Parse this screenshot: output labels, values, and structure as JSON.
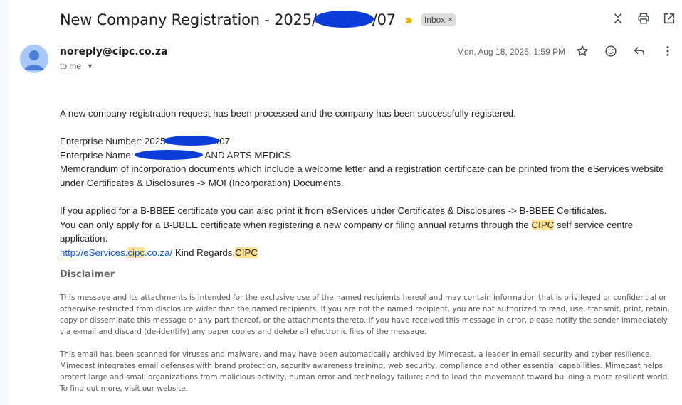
{
  "email": {
    "subject_prefix": "New Company Registration - 2025/",
    "subject_suffix": "/07",
    "label_chip": "Inbox",
    "label_chip_close": "×",
    "sender": "noreply@cipc.co.za",
    "recipient_label": "to me",
    "date": "Mon, Aug 18, 2025, 1:59 PM"
  },
  "body": {
    "intro": "A new company registration request has been processed and the company has been successfully registered.",
    "enterprise_number_prefix": "Enterprise Number: 2025",
    "enterprise_number_suffix": "/07",
    "enterprise_name_prefix": "Enterprise Name:",
    "enterprise_name_suffix": "AND ARTS MEDICS",
    "memorandum": "Memorandum of incorporation documents which include a welcome letter and a registration certificate can be printed from the eServices website under Certificates & Disclosures -> MOI (Incorporation) Documents.",
    "bbbee_1": "If you applied for a B-BBEE certificate you can also print it from eServices under Certificates & Disclosures -> B-BBEE Certificates.",
    "bbbee_2_before": "You can only apply for a B-BBEE certificate when registering a new company or filing annual returns through the ",
    "bbbee_2_highlight": "CIPC",
    "bbbee_2_after": " self service centre application.",
    "link_part1": "http://eServices.",
    "link_highlight": "cipc",
    "link_part2": ".co.za/",
    "regards": " Kind Regards,",
    "signature": "CIPC"
  },
  "disclaimer": {
    "title": "Disclaimer",
    "paragraph_1": "This message and its attachments is intended for the exclusive use of the named recipients hereof and may contain information that is privileged or confidential or otherwise restricted from disclosure wider than the named recipients. If you are not the named recipient, you are not authorized to read, use, transmit, print, retain, copy or disseminate this message or any part thereof, or the attachments thereto. If you have received this message in error, please notify the sender immediately via e-mail and discard (de-identify) any paper copies and delete all electronic files of the message.",
    "paragraph_2": "This email has been scanned for viruses and malware, and may have been automatically archived by Mimecast, a leader in email security and cyber resilience. Mimecast integrates email defenses with brand protection, security awareness training, web security, compliance and other essential capabilities. Mimecast helps protect large and small organizations from malicious activity, human error and technology failure; and to lead the movement toward building a more resilient world. To find out more, visit our website."
  },
  "icons": {
    "toolbar": [
      "collapse-all-icon",
      "print-icon",
      "open-in-new-window-icon"
    ],
    "message": [
      "star-icon",
      "emoji-icon",
      "reply-icon",
      "more-vert-icon"
    ],
    "importance": "importance-marker-icon",
    "avatar": "avatar-person-icon",
    "redaction_color": "#0b3dd8",
    "highlight_color": "#fde293",
    "link_color": "#1155cc"
  }
}
